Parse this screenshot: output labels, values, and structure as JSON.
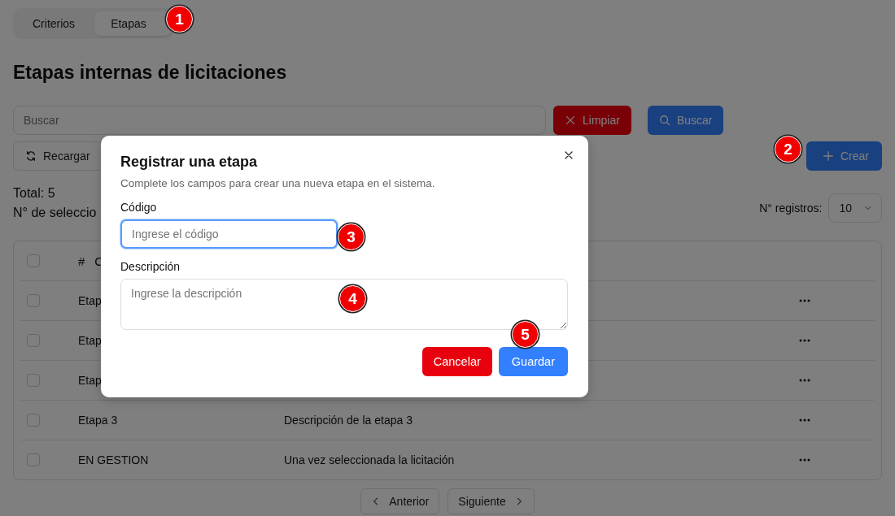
{
  "tabs": [
    {
      "label": "Criterios",
      "selected": false
    },
    {
      "label": "Etapas",
      "selected": true
    }
  ],
  "page_title": "Etapas internas de licitaciones",
  "search": {
    "placeholder": "Buscar"
  },
  "clear_button": "Limpiar",
  "search_button": "Buscar",
  "reload_button": "Recargar",
  "create_button": "Crear",
  "total": "Total: 5",
  "selected_count": "N° de seleccio",
  "page_size": {
    "label": "N° registros:",
    "value": "10"
  },
  "table": {
    "header_checkbox": {
      "checked": false
    },
    "hash": "#",
    "column_2": "C",
    "rows": [
      {
        "checked": false,
        "code": "Etap"
      },
      {
        "checked": false,
        "code": "Etap"
      },
      {
        "checked": false,
        "code": "Etap"
      },
      {
        "checked": false,
        "code": "Etapa 3",
        "description": "Descripción de la etapa 3"
      },
      {
        "checked": false,
        "code": "EN GESTION",
        "description": "Una vez seleccionada la licitación"
      }
    ]
  },
  "pagination": {
    "previous": "Anterior",
    "next": "Siguiente"
  },
  "dialog": {
    "title": "Registrar una etapa",
    "subtitle": "Complete los campos para crear una nueva etapa en el sistema.",
    "fields": [
      {
        "kind": "input",
        "label": "Código",
        "placeholder": "Ingrese el código",
        "focused": true
      },
      {
        "kind": "textarea",
        "label": "Descripción",
        "placeholder": "Ingrese la descripción",
        "focused": false
      }
    ],
    "cancel_button": "Cancelar",
    "save_button": "Guardar"
  },
  "markers": [
    "1",
    "2",
    "3",
    "4",
    "5"
  ]
}
